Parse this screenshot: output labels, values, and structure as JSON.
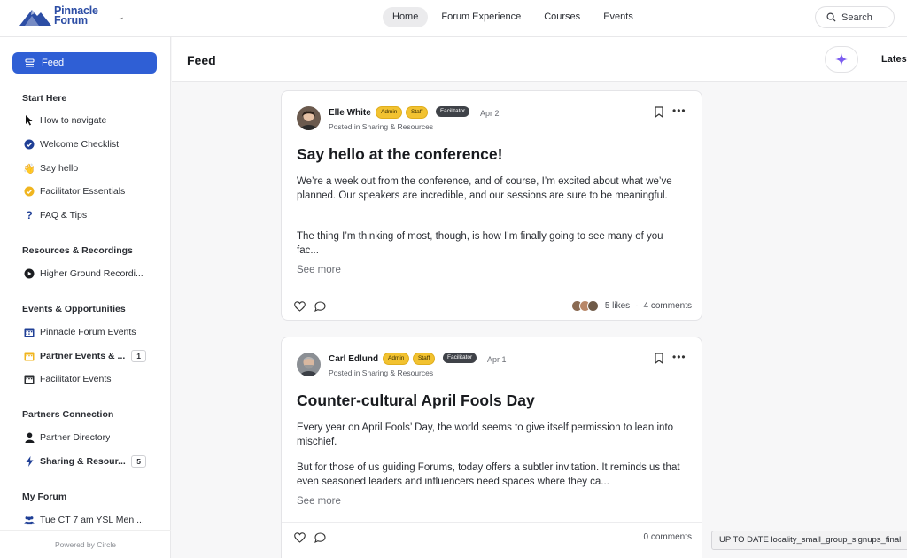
{
  "nav": {
    "logo_line1": "Pinnacle",
    "logo_line2": "Forum",
    "links": [
      "Home",
      "Forum Experience",
      "Courses",
      "Events"
    ],
    "search_label": "Search"
  },
  "sidebar": {
    "feed_label": "Feed",
    "sections": [
      {
        "title": "Start Here",
        "items": [
          {
            "label": "How to navigate",
            "icon": "cursor-icon"
          },
          {
            "label": "Welcome Checklist",
            "icon": "check-circle-icon"
          },
          {
            "label": "Say hello",
            "icon": "wave-icon"
          },
          {
            "label": "Facilitator Essentials",
            "icon": "check-circle-gold-icon"
          },
          {
            "label": "FAQ & Tips",
            "icon": "question-icon"
          }
        ]
      },
      {
        "title": "Resources & Recordings",
        "items": [
          {
            "label": "Higher Ground Recordi...",
            "icon": "play-icon"
          }
        ]
      },
      {
        "title": "Events & Opportunities",
        "items": [
          {
            "label": "Pinnacle Forum Events",
            "icon": "calendar-icon"
          },
          {
            "label": "Partner Events & ...",
            "icon": "calendar-gold-icon",
            "count": "1"
          },
          {
            "label": "Facilitator Events",
            "icon": "calendar-dark-icon"
          }
        ]
      },
      {
        "title": "Partners Connection",
        "items": [
          {
            "label": "Partner Directory",
            "icon": "person-icon"
          },
          {
            "label": "Sharing & Resour...",
            "icon": "bolt-icon",
            "count": "5"
          }
        ]
      },
      {
        "title": "My Forum",
        "items": [
          {
            "label": "Tue CT 7 am YSL Men ...",
            "icon": "group-icon"
          }
        ]
      }
    ],
    "powered_by": "Powered by Circle"
  },
  "feed_header": {
    "title": "Feed",
    "sort_label": "Latest"
  },
  "posts": [
    {
      "author": "Elle White",
      "tags": [
        "Admin",
        "Staff",
        "Facilitator"
      ],
      "date": "Apr 2",
      "posted_in": "Posted in Sharing & Resources",
      "title": "Say hello at the conference!",
      "para1": "We’re a week out from the conference, and of course, I’m excited about what we’ve planned. Our speakers are incredible, and our sessions are sure to be meaningful.",
      "para2": "The thing I’m thinking of most, though, is how I’m finally going to see many of you fac...",
      "see_more": "See more",
      "likes": "5 likes",
      "sep": "·",
      "comments": "4 comments"
    },
    {
      "author": "Carl Edlund",
      "tags": [
        "Admin",
        "Staff",
        "Facilitator"
      ],
      "date": "Apr 1",
      "posted_in": "Posted in Sharing & Resources",
      "title": "Counter-cultural April Fools Day",
      "para1": "Every year on April Fools’ Day, the world seems to give itself permission to lean into mischief.",
      "para2": "But for those of us guiding Forums, today offers a subtler invitation. It reminds us that even seasoned leaders and influencers need spaces where they ca...",
      "see_more": "See more",
      "comments": "0 comments"
    }
  ],
  "toast": "UP TO DATE locality_small_group_signups_final",
  "colors": {
    "primary": "#2f5fd5",
    "logo": "#2d4ea5",
    "tag_gold": "#f2c230",
    "tag_dark": "#3f4248"
  }
}
